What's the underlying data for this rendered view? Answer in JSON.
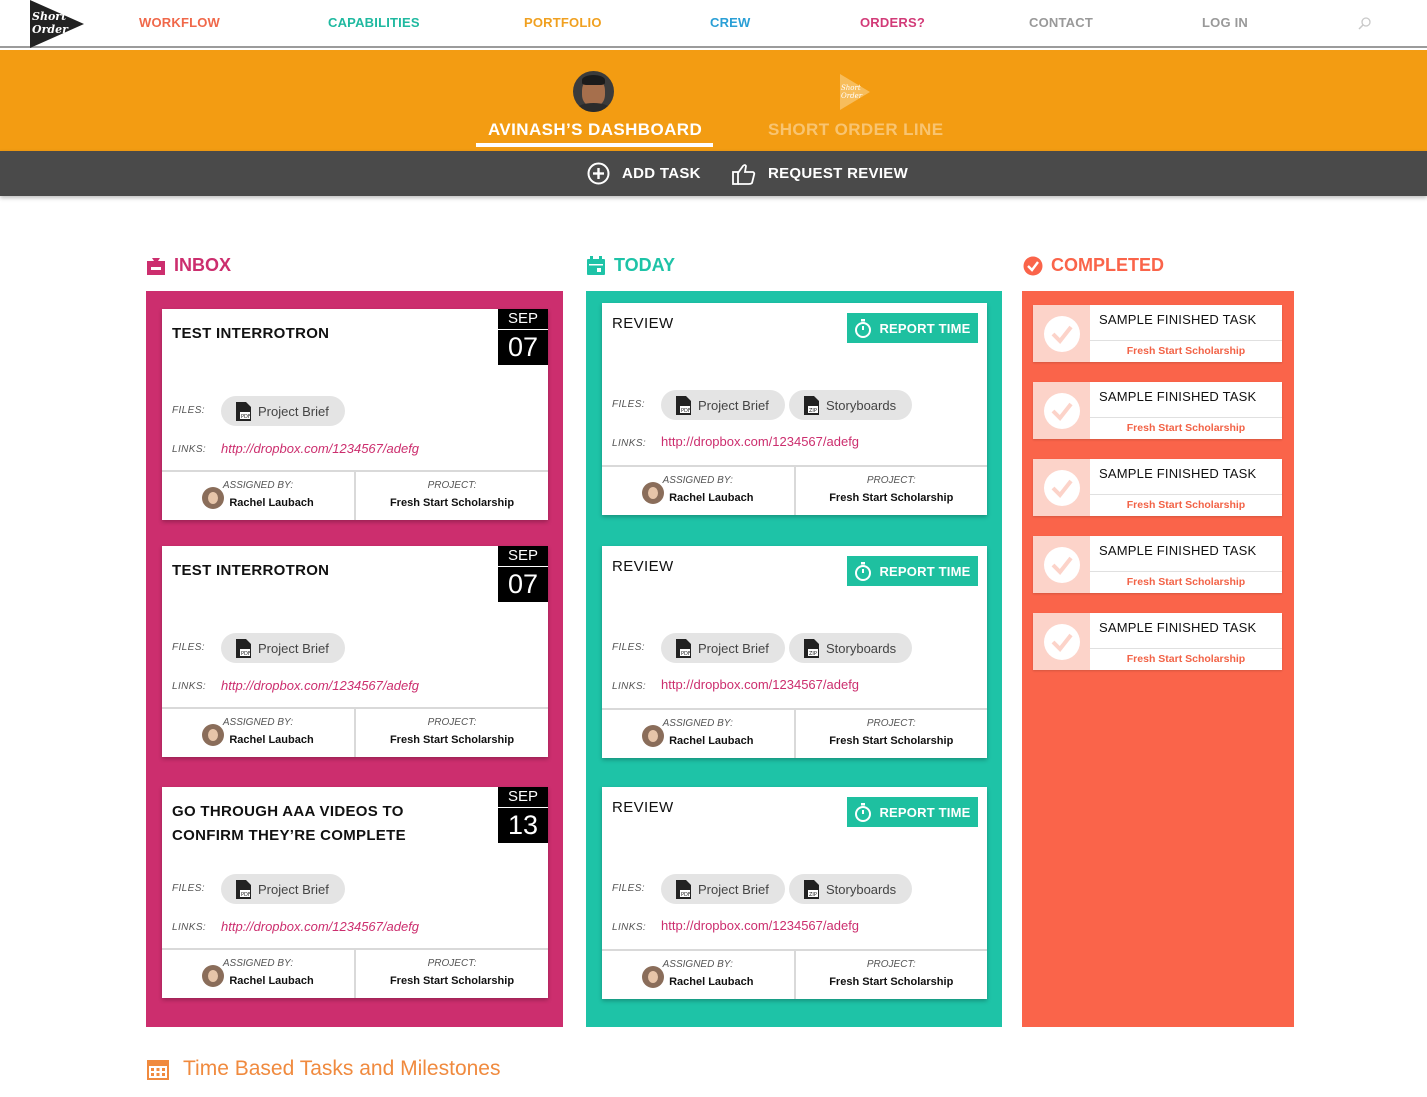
{
  "brand": {
    "logo_text_1": "Short",
    "logo_text_2": "Order"
  },
  "nav": [
    {
      "label": "WORKFLOW",
      "color": "#f0684a"
    },
    {
      "label": "CAPABILITIES",
      "color": "#1fb9a0"
    },
    {
      "label": "PORTFOLIO",
      "color": "#f0a020"
    },
    {
      "label": "CREW",
      "color": "#2a9fd6"
    },
    {
      "label": "ORDERS?",
      "color": "#d23b78"
    },
    {
      "label": "CONTACT",
      "color": "#999999"
    },
    {
      "label": "LOG IN",
      "color": "#999999"
    }
  ],
  "dashboard_tabs": {
    "active": "AVINASH’S DASHBOARD",
    "inactive": "SHORT ORDER LINE"
  },
  "toolbar": {
    "add_task": "ADD TASK",
    "request_review": "REQUEST REVIEW"
  },
  "columns": {
    "inbox": {
      "title": "INBOX",
      "color": "#cc2e6e"
    },
    "today": {
      "title": "TODAY",
      "color": "#1ec3a7"
    },
    "completed": {
      "title": "COMPLETED",
      "color": "#fa644a"
    }
  },
  "labels": {
    "files": "FILES:",
    "links": "LINKS:",
    "assigned_by": "ASSIGNED BY:",
    "project": "PROJECT:",
    "report_time": "REPORT TIME"
  },
  "inbox_cards": [
    {
      "title": "TEST INTERROTRON",
      "month": "SEP",
      "day": "07",
      "files": [
        "Project Brief"
      ],
      "link": "http://dropbox.com/1234567/adefg",
      "assigned_by": "Rachel Laubach",
      "project": "Fresh Start Scholarship"
    },
    {
      "title": "TEST INTERROTRON",
      "month": "SEP",
      "day": "07",
      "files": [
        "Project Brief"
      ],
      "link": "http://dropbox.com/1234567/adefg",
      "assigned_by": "Rachel Laubach",
      "project": "Fresh Start Scholarship"
    },
    {
      "title_line1": "GO THROUGH AAA VIDEOS TO",
      "title_line2": "CONFIRM THEY’RE COMPLETE",
      "month": "SEP",
      "day": "13",
      "files": [
        "Project Brief"
      ],
      "link": "http://dropbox.com/1234567/adefg",
      "assigned_by": "Rachel Laubach",
      "project": "Fresh Start Scholarship"
    }
  ],
  "today_cards": [
    {
      "title": "REVIEW",
      "files": [
        "Project Brief",
        "Storyboards"
      ],
      "link": "http://dropbox.com/1234567/adefg",
      "assigned_by": "Rachel Laubach",
      "project": "Fresh Start Scholarship"
    },
    {
      "title": "REVIEW",
      "files": [
        "Project Brief",
        "Storyboards"
      ],
      "link": "http://dropbox.com/1234567/adefg",
      "assigned_by": "Rachel Laubach",
      "project": "Fresh Start Scholarship"
    },
    {
      "title": "REVIEW",
      "files": [
        "Project Brief",
        "Storyboards"
      ],
      "link": "http://dropbox.com/1234567/adefg",
      "assigned_by": "Rachel Laubach",
      "project": "Fresh Start Scholarship"
    }
  ],
  "completed": [
    {
      "title": "SAMPLE FINISHED TASK",
      "project": "Fresh Start Scholarship"
    },
    {
      "title": "SAMPLE FINISHED TASK",
      "project": "Fresh Start Scholarship"
    },
    {
      "title": "SAMPLE FINISHED TASK",
      "project": "Fresh Start Scholarship"
    },
    {
      "title": "SAMPLE FINISHED TASK",
      "project": "Fresh Start Scholarship"
    },
    {
      "title": "SAMPLE FINISHED TASK",
      "project": "Fresh Start Scholarship"
    }
  ],
  "footer": {
    "heading": "Time Based Tasks and Milestones"
  },
  "icons": {
    "search": "search-icon",
    "inbox": "inbox-icon",
    "today": "calendar-icon",
    "completed": "check-circle-icon",
    "add": "plus-circle-icon",
    "review": "thumbs-up-icon",
    "report": "stopwatch-icon",
    "file": "pdf-file-icon",
    "footer": "calendar-grid-icon"
  }
}
